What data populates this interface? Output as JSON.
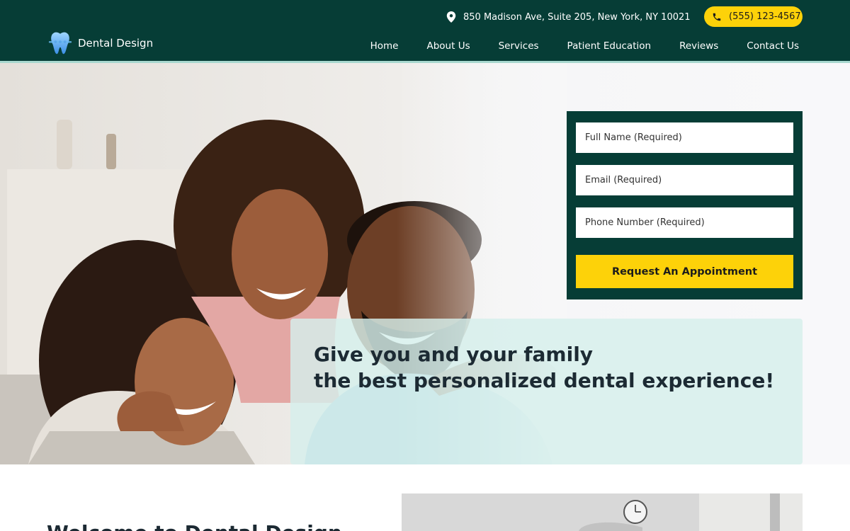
{
  "brand": {
    "name": "Dental Design",
    "logo_icon": "tooth-icon",
    "primary_color": "#063d36",
    "accent_color": "#fdd209"
  },
  "header": {
    "address": "850 Madison Ave, Suite 205, New York, NY 10021",
    "address_icon": "location-pin-icon",
    "phone": "(555) 123-4567",
    "phone_icon": "phone-icon"
  },
  "nav": {
    "items": [
      "Home",
      "About Us",
      "Services",
      "Patient Education",
      "Reviews",
      "Contact Us"
    ]
  },
  "form": {
    "name_placeholder": "Full Name (Required)",
    "email_placeholder": "Email (Required)",
    "phone_placeholder": "Phone Number (Required)",
    "submit_label": "Request An Appointment"
  },
  "hero": {
    "tagline_line1": "Give you and your family",
    "tagline_line2": "the best personalized dental experience!"
  },
  "welcome": {
    "title": "Welcome to Dental Design"
  }
}
